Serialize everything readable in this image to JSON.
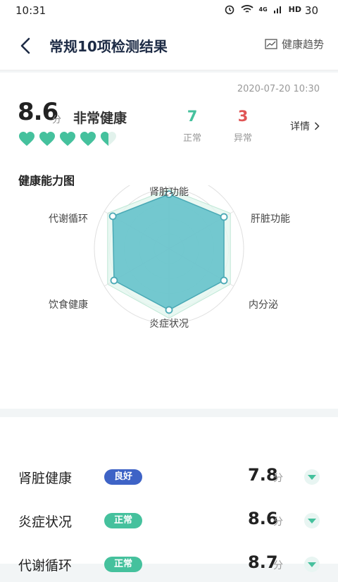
{
  "status_bar": {
    "time": "10:31",
    "network": "4G",
    "signal": "HD",
    "battery": "30"
  },
  "header": {
    "title": "常规10项检测结果",
    "trend_label": "健康趋势"
  },
  "summary": {
    "datetime": "2020-07-20 10:30",
    "score": "8.6",
    "score_unit": "分",
    "level": "非常健康",
    "hearts": 4.5,
    "normal_count": "7",
    "normal_label": "正常",
    "abnormal_count": "3",
    "abnormal_label": "异常",
    "detail_label": "详情"
  },
  "radar": {
    "title": "健康能力图",
    "axes": [
      "肾脏功能",
      "肝脏功能",
      "内分泌",
      "炎症状况",
      "饮食健康",
      "代谢循环"
    ],
    "values": [
      0.73,
      0.85,
      0.85,
      0.82,
      0.85,
      0.87
    ],
    "band_values": [
      0.8,
      0.95,
      0.95,
      0.93,
      0.95,
      0.95
    ],
    "fill_color": "#5ebfc9",
    "band_color": "#e4f6ef"
  },
  "items": [
    {
      "name": "肾脏健康",
      "badge": "良好",
      "badge_color": "#3e63c6",
      "value": "7.8",
      "unit": "分"
    },
    {
      "name": "炎症状况",
      "badge": "正常",
      "badge_color": "#45c19d",
      "value": "8.6",
      "unit": "分"
    },
    {
      "name": "代谢循环",
      "badge": "正常",
      "badge_color": "#45c19d",
      "value": "8.7",
      "unit": "分"
    }
  ]
}
